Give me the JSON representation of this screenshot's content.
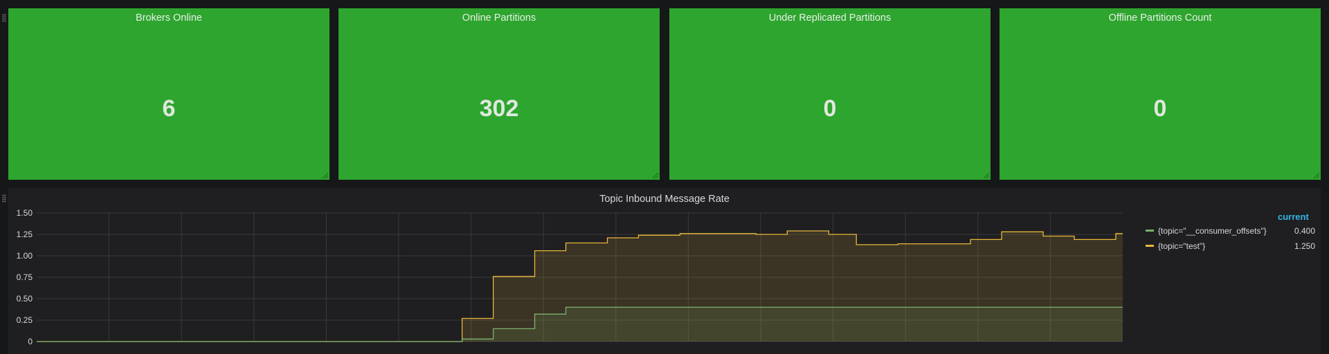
{
  "stats": [
    {
      "title": "Brokers Online",
      "value": "6"
    },
    {
      "title": "Online Partitions",
      "value": "302"
    },
    {
      "title": "Under Replicated Partitions",
      "value": "0"
    },
    {
      "title": "Offline Partitions Count",
      "value": "0"
    }
  ],
  "stat_color": "#2ea52e",
  "graph": {
    "title": "Topic Inbound Message Rate",
    "legend_header": "current",
    "legend": [
      {
        "label": "{topic=\"__consumer_offsets\"}",
        "value": "0.400",
        "color": "#7eb26d"
      },
      {
        "label": "{topic=\"test\"}",
        "value": "1.250",
        "color": "#eab839"
      }
    ]
  },
  "chart_data": {
    "type": "line",
    "title": "Topic Inbound Message Rate",
    "ylim": [
      0,
      1.5
    ],
    "yticks": [
      "0",
      "0.25",
      "0.50",
      "0.75",
      "1.00",
      "1.25",
      "1.50"
    ],
    "x_range": [
      0,
      1570
    ],
    "grid": true,
    "series": [
      {
        "name": "{topic=\"__consumer_offsets\"}",
        "color": "#7eb26d",
        "points": [
          [
            0,
            0
          ],
          [
            615,
            0
          ],
          [
            615,
            0.03
          ],
          [
            660,
            0.03
          ],
          [
            660,
            0.15
          ],
          [
            720,
            0.15
          ],
          [
            720,
            0.32
          ],
          [
            765,
            0.32
          ],
          [
            765,
            0.4
          ],
          [
            1570,
            0.4
          ]
        ]
      },
      {
        "name": "{topic=\"test\"}",
        "color": "#eab839",
        "points": [
          [
            0,
            0
          ],
          [
            615,
            0
          ],
          [
            615,
            0.27
          ],
          [
            660,
            0.27
          ],
          [
            660,
            0.76
          ],
          [
            720,
            0.76
          ],
          [
            720,
            1.06
          ],
          [
            765,
            1.06
          ],
          [
            765,
            1.15
          ],
          [
            825,
            1.15
          ],
          [
            825,
            1.21
          ],
          [
            870,
            1.21
          ],
          [
            870,
            1.24
          ],
          [
            930,
            1.24
          ],
          [
            930,
            1.26
          ],
          [
            1040,
            1.26
          ],
          [
            1040,
            1.25
          ],
          [
            1085,
            1.25
          ],
          [
            1085,
            1.29
          ],
          [
            1145,
            1.29
          ],
          [
            1145,
            1.25
          ],
          [
            1185,
            1.25
          ],
          [
            1185,
            1.13
          ],
          [
            1245,
            1.13
          ],
          [
            1245,
            1.14
          ],
          [
            1350,
            1.14
          ],
          [
            1350,
            1.19
          ],
          [
            1395,
            1.19
          ],
          [
            1395,
            1.28
          ],
          [
            1455,
            1.28
          ],
          [
            1455,
            1.23
          ],
          [
            1500,
            1.23
          ],
          [
            1500,
            1.19
          ],
          [
            1560,
            1.19
          ],
          [
            1560,
            1.26
          ],
          [
            1570,
            1.26
          ]
        ]
      }
    ]
  }
}
